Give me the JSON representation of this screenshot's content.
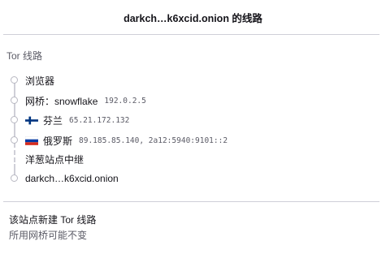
{
  "header": {
    "title": "darkch…k6xcid.onion 的线路"
  },
  "circuit": {
    "section_title": "Tor 线路",
    "nodes": [
      {
        "label": "浏览器",
        "ip": ""
      },
      {
        "label": "网桥：snowflake",
        "ip": "192.0.2.5"
      },
      {
        "label": "芬兰",
        "ip": "65.21.172.132",
        "flag": "finland-flag-icon"
      },
      {
        "label": "俄罗斯",
        "ip": "89.185.85.140, 2a12:5940:9101::2",
        "flag": "russia-flag-icon"
      },
      {
        "label": "洋葱站点中继",
        "ip": ""
      },
      {
        "label": "darkch…k6xcid.onion",
        "ip": ""
      }
    ]
  },
  "footer": {
    "new_circuit_label": "该站点新建 Tor 线路",
    "note": "所用网桥可能不变"
  },
  "colors": {
    "text": "#15141a",
    "muted": "#5b5b66",
    "separator": "#cfcfd8",
    "finland_blue": "#003580",
    "russia_blue": "#0039a6",
    "russia_red": "#d52b1e"
  }
}
